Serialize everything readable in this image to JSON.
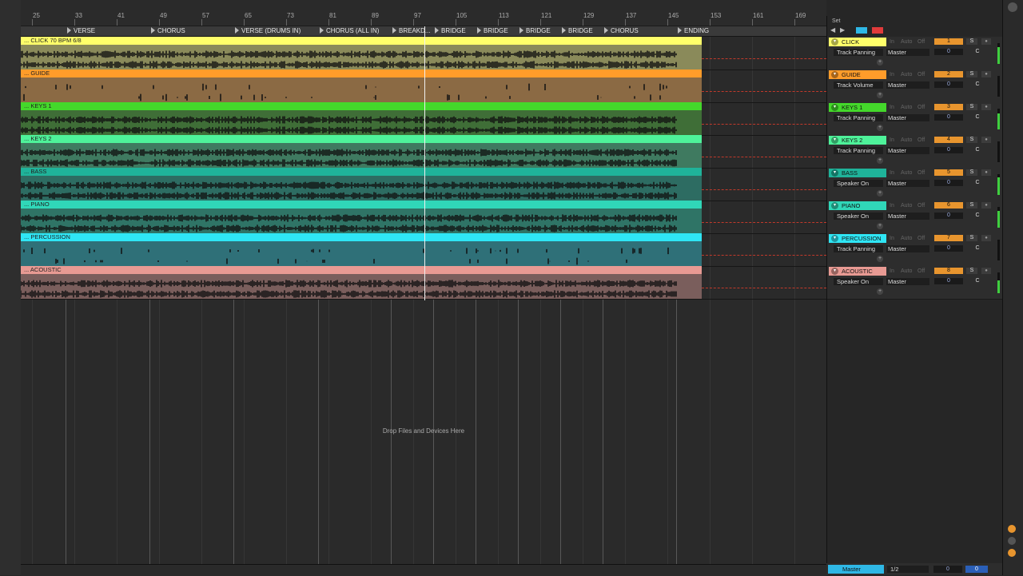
{
  "ruler": {
    "bars": [
      "25",
      "33",
      "41",
      "49",
      "57",
      "65",
      "73",
      "81",
      "89",
      "97",
      "105",
      "113",
      "121",
      "129",
      "137",
      "145",
      "153",
      "161",
      "169"
    ]
  },
  "locators": [
    {
      "name": "VERSE"
    },
    {
      "name": "CHORUS"
    },
    {
      "name": "VERSE (DRUMS IN)"
    },
    {
      "name": "CHORUS (ALL IN)"
    },
    {
      "name": "BREAKD..."
    },
    {
      "name": "BRIDGE"
    },
    {
      "name": "BRIDGE"
    },
    {
      "name": "BRIDGE"
    },
    {
      "name": "BRIDGE"
    },
    {
      "name": "CHORUS"
    },
    {
      "name": "ENDING"
    }
  ],
  "tracks": [
    {
      "clip_label": "... CLICK 70 BPM 6/8",
      "name": "CLICK",
      "color": "#ffff6a",
      "body": "#8a8a5a",
      "param": "Track Panning",
      "output": "Master",
      "number": "1",
      "volume": "0",
      "pan": "C",
      "meter": 0.8
    },
    {
      "clip_label": "... GUIDE",
      "name": "GUIDE",
      "color": "#ff9c2a",
      "body": "#8b6a44",
      "param": "Track Volume",
      "output": "Master",
      "number": "2",
      "volume": "0",
      "pan": "C",
      "meter": 0.0
    },
    {
      "clip_label": "... KEYS 1",
      "name": "KEYS 1",
      "color": "#44d82b",
      "body": "#3f6e37",
      "param": "Track Panning",
      "output": "Master",
      "number": "3",
      "volume": "0",
      "pan": "C",
      "meter": 0.75
    },
    {
      "clip_label": "... KEYS 2",
      "name": "KEYS 2",
      "color": "#4ef29a",
      "body": "#3f7a60",
      "param": "Track Panning",
      "output": "Master",
      "number": "4",
      "volume": "0",
      "pan": "C",
      "meter": 0.0
    },
    {
      "clip_label": "... BASS",
      "name": "BASS",
      "color": "#1fb39a",
      "body": "#2d6c62",
      "param": "Speaker On",
      "output": "Master",
      "number": "5",
      "volume": "0",
      "pan": "C",
      "meter": 0.85
    },
    {
      "clip_label": "... PIANO",
      "name": "PIANO",
      "color": "#30d7b8",
      "body": "#2f7466",
      "param": "Speaker On",
      "output": "Master",
      "number": "6",
      "volume": "0",
      "pan": "C",
      "meter": 0.8
    },
    {
      "clip_label": "... PERCUSSION",
      "name": "PERCUSSION",
      "color": "#2fe6f5",
      "body": "#2f7078",
      "param": "Track Panning",
      "output": "Master",
      "number": "7",
      "volume": "0",
      "pan": "C",
      "meter": 0.0
    },
    {
      "clip_label": "... ACOUSTIC",
      "name": "ACOUSTIC",
      "color": "#e89a93",
      "body": "#7a5e5c",
      "param": "Speaker On",
      "output": "Master",
      "number": "8",
      "volume": "0",
      "pan": "C",
      "meter": 0.6
    }
  ],
  "mixer_controls": {
    "in": "In",
    "auto": "Auto",
    "off": "Off",
    "solo": "S",
    "set": "Set"
  },
  "drop_text": "Drop Files and Devices Here",
  "master": {
    "name": "Master",
    "input": "1/2",
    "volume": "0",
    "vol2": "0",
    "color": "#2fb8e6"
  },
  "colors": {
    "accent": "#ff9c2a",
    "record": "#e03b3b",
    "dash": "#c0392b"
  }
}
